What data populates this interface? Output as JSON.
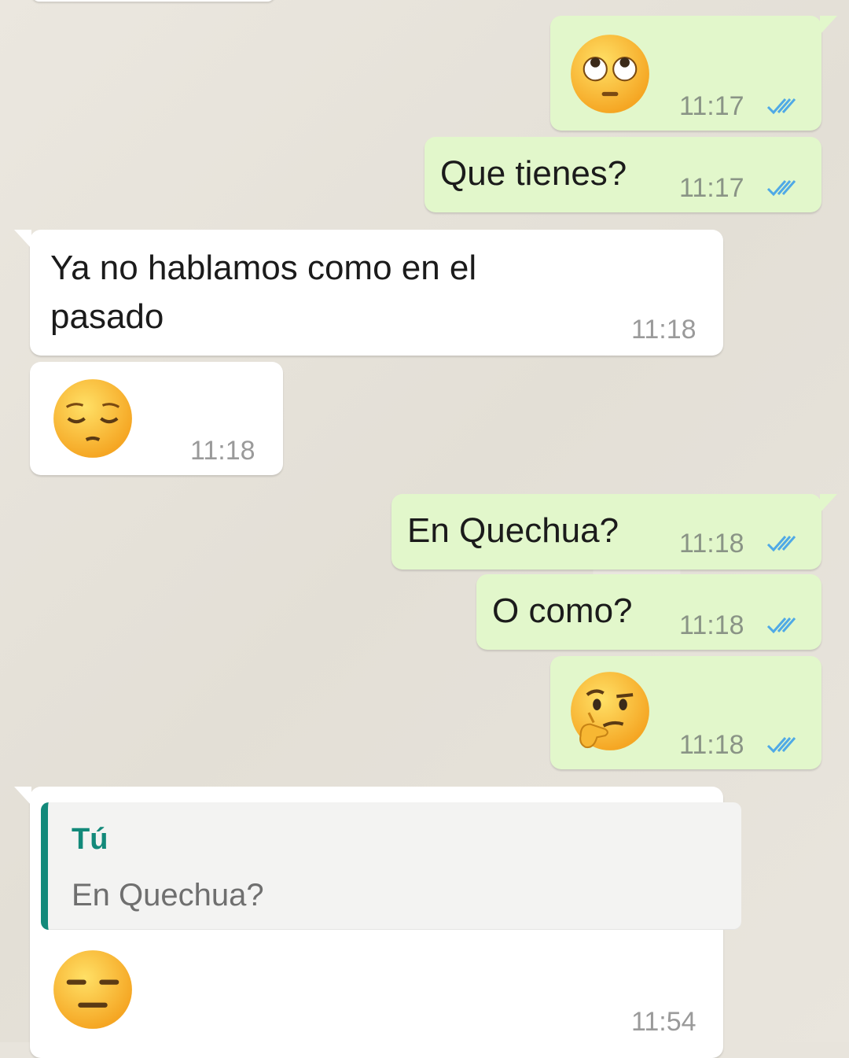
{
  "messages": [
    {
      "direction": "outgoing",
      "emoji": "face-with-rolling-eyes",
      "time": "11:17",
      "status": "read"
    },
    {
      "direction": "outgoing",
      "text": "Que tienes?",
      "time": "11:17",
      "status": "read"
    },
    {
      "direction": "incoming",
      "text": "Ya no hablamos como en el\npasado",
      "time": "11:18"
    },
    {
      "direction": "incoming",
      "emoji": "pensive-face",
      "time": "11:18"
    },
    {
      "direction": "outgoing",
      "text": "En Quechua?",
      "time": "11:18",
      "status": "read"
    },
    {
      "direction": "outgoing",
      "text": "O como?",
      "time": "11:18",
      "status": "read"
    },
    {
      "direction": "outgoing",
      "emoji": "thinking-face",
      "time": "11:18",
      "status": "read"
    },
    {
      "direction": "incoming",
      "emoji": "expressionless-face",
      "time": "11:54",
      "reply_to": {
        "author": "Tú",
        "text": "En Quechua?"
      }
    }
  ],
  "colors": {
    "outgoing_bubble": "#e2f7cb",
    "incoming_bubble": "#ffffff",
    "read_ticks": "#4fa9e6",
    "quote_accent": "#12897a",
    "wallpaper": "#e8e4dc"
  }
}
